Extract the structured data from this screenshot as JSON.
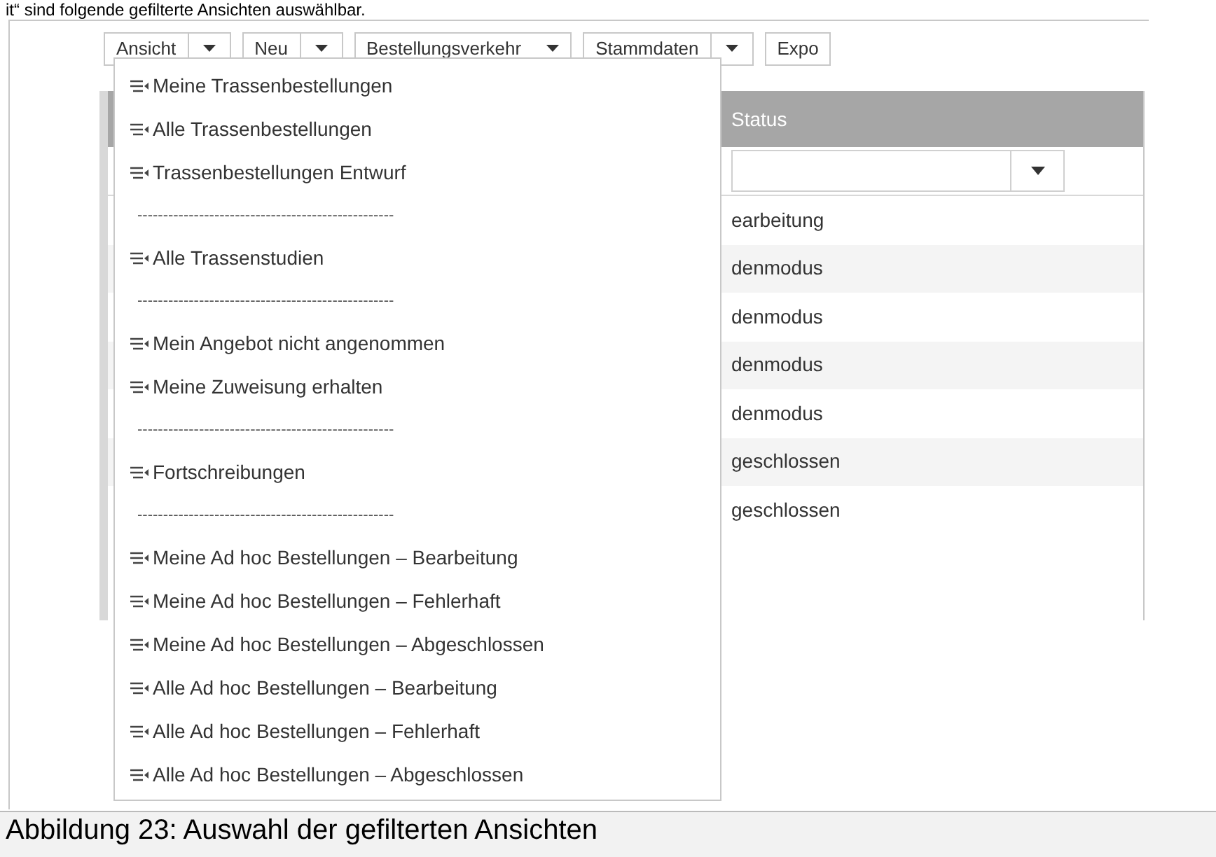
{
  "intro_text": "it“ sind folgende gefilterte Ansichten auswählbar.",
  "toolbar": [
    {
      "label": "Ansicht",
      "dropdown": true,
      "kind": "split"
    },
    {
      "label": "Neu",
      "dropdown": true,
      "kind": "split"
    },
    {
      "label": "Bestellungsverkehr",
      "dropdown": true,
      "kind": "menu"
    },
    {
      "label": "Stammdaten",
      "dropdown": true,
      "kind": "split"
    },
    {
      "label": "Expo",
      "dropdown": false,
      "kind": "split"
    }
  ],
  "table": {
    "columns": [
      "Status"
    ],
    "rows": [
      {
        "status": "earbeitung"
      },
      {
        "status": "denmodus"
      },
      {
        "status": "denmodus"
      },
      {
        "status": "denmodus"
      },
      {
        "status": "denmodus"
      },
      {
        "status": "geschlossen"
      },
      {
        "status": "geschlossen"
      }
    ]
  },
  "view_menu": [
    {
      "kind": "view",
      "label": "Meine Trassenbestellungen"
    },
    {
      "kind": "view",
      "label": "Alle Trassenbestellungen"
    },
    {
      "kind": "view",
      "label": "Trassenbestellungen Entwurf"
    },
    {
      "kind": "separator",
      "label": "--------------------------------------------------"
    },
    {
      "kind": "view",
      "label": "Alle Trassenstudien"
    },
    {
      "kind": "separator",
      "label": "--------------------------------------------------"
    },
    {
      "kind": "view",
      "label": "Mein Angebot nicht angenommen"
    },
    {
      "kind": "view",
      "label": "Meine Zuweisung erhalten"
    },
    {
      "kind": "separator",
      "label": "--------------------------------------------------"
    },
    {
      "kind": "view",
      "label": "Fortschreibungen"
    },
    {
      "kind": "separator",
      "label": "--------------------------------------------------"
    },
    {
      "kind": "view",
      "label": "Meine Ad hoc Bestellungen – Bearbeitung"
    },
    {
      "kind": "view",
      "label": "Meine Ad hoc Bestellungen – Fehlerhaft"
    },
    {
      "kind": "view",
      "label": "Meine Ad hoc Bestellungen – Abgeschlossen"
    },
    {
      "kind": "view",
      "label": "Alle Ad hoc Bestellungen – Bearbeitung"
    },
    {
      "kind": "view",
      "label": "Alle Ad hoc Bestellungen – Fehlerhaft"
    },
    {
      "kind": "view",
      "label": "Alle Ad hoc Bestellungen – Abgeschlossen"
    }
  ],
  "caption": "Abbildung 23: Auswahl der gefilterten Ansichten"
}
